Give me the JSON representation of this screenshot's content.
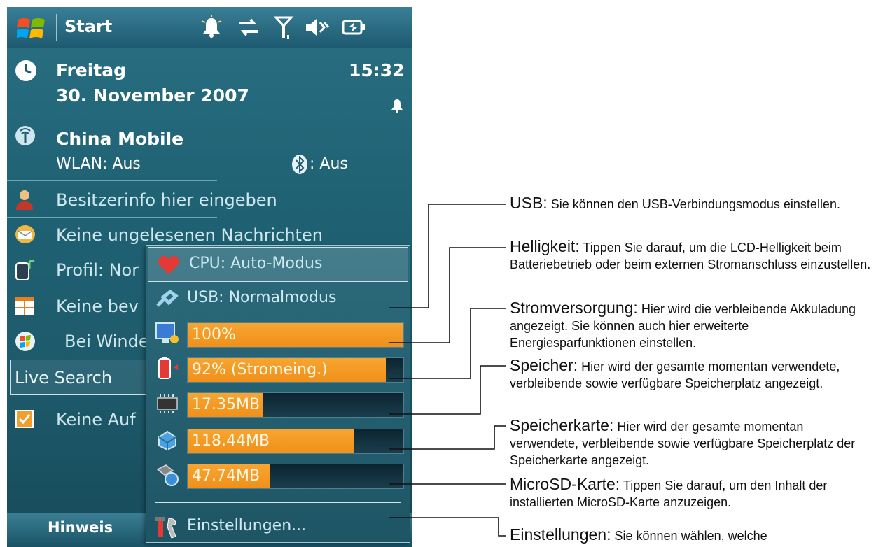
{
  "taskbar": {
    "start_label": "Start"
  },
  "today": {
    "day": "Freitag",
    "date": "30. November 2007",
    "time": "15:32"
  },
  "network": {
    "carrier": "China Mobile",
    "wlan": "WLAN: Aus",
    "bluetooth": ": Aus"
  },
  "items": {
    "owner": "Besitzerinfo hier eingeben",
    "messages": "Keine ungelesenen Nachrichten",
    "profile": "Profil: Nor",
    "appointments": "Keine bev",
    "windows_live": "Bei Winde",
    "tasks": "Keine Auf"
  },
  "search": {
    "label": "Live Search"
  },
  "softkey": {
    "left": "Hinweis"
  },
  "popup": {
    "cpu": "CPU: Auto-Modus",
    "usb": "USB: Normalmodus",
    "bars": [
      {
        "name": "brightness",
        "label": "100%",
        "fill": 1.0
      },
      {
        "name": "battery",
        "label": "92% (Stromeing.)",
        "fill": 0.92
      },
      {
        "name": "memory",
        "label": "17.35MB",
        "fill": 0.35
      },
      {
        "name": "storage-card",
        "label": "118.44MB",
        "fill": 0.77
      },
      {
        "name": "microsd",
        "label": "47.74MB",
        "fill": 0.38
      }
    ],
    "settings": "Einstellungen..."
  },
  "callouts": {
    "usb": {
      "term": "USB:",
      "text": " Sie können den USB-Verbindungsmodus einstellen."
    },
    "brightness": {
      "term": "Helligkeit:",
      "text": " Tippen Sie darauf, um die LCD-Helligkeit beim Batteriebetrieb oder beim externen Stromanschluss einzustellen."
    },
    "power": {
      "term": "Stromversorgung:",
      "text": " Hier wird die verbleibende Akkuladung angezeigt. Sie können auch hier erweiterte Energiesparfunktionen einstellen."
    },
    "memory": {
      "term": "Speicher:",
      "text": " Hier wird der gesamte momentan verwendete, verbleibende sowie verfügbare Speicherplatz angezeigt."
    },
    "card": {
      "term": "Speicherkarte:",
      "text": " Hier wird der gesamte momentan verwendete, verbleibende sowie verfügbare Speicherplatz der Speicherkarte angezeigt."
    },
    "microsd": {
      "term": "MicroSD-Karte:",
      "text": " Tippen Sie darauf, um den Inhalt der installierten MicroSD-Karte anzuzeigen."
    },
    "settings": {
      "term": "Einstellungen:",
      "text": " Sie können wählen, welche"
    }
  },
  "colors": {
    "accent_orange": "#f0901a",
    "screen_teal": "#1f6274"
  }
}
